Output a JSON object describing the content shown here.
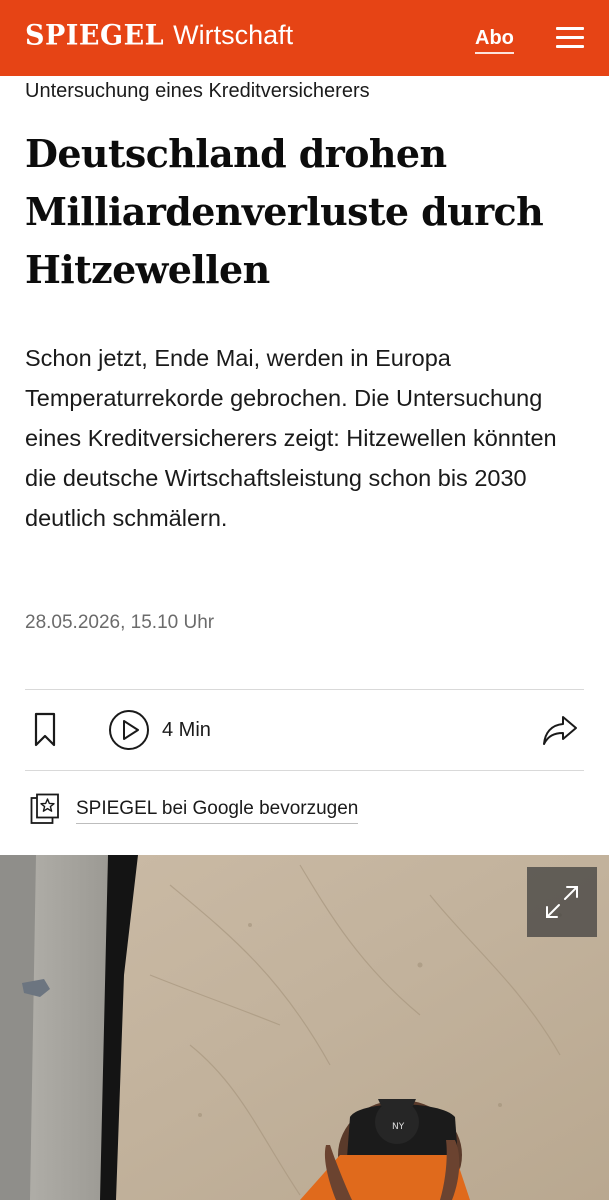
{
  "header": {
    "brand": "SPIEGEL",
    "section": "Wirtschaft",
    "abo_label": "Abo",
    "menu_icon": "hamburger-menu-icon",
    "bar_color": "#e64415"
  },
  "article": {
    "kicker": "Untersuchung eines Kreditversicherers",
    "headline": "Deutschland drohen Milliardenverluste durch Hitzewellen",
    "teaser": "Schon jetzt, Ende Mai, werden in Europa Temperaturrekorde gebrochen. Die Untersuchung eines Kreditversicherers zeigt: Hitzewellen könnten die deutsche Wirtschaftsleistung schon bis 2030 deutlich schmälern.",
    "date": "28.05.2026, 15.10 Uhr"
  },
  "toolbar": {
    "bookmark_icon": "bookmark-icon",
    "play_icon": "play-circle-icon",
    "duration": "4 Min",
    "share_icon": "share-arrow-icon"
  },
  "google": {
    "icon": "star-badge-icon",
    "label": "SPIEGEL bei Google bevorzugen"
  },
  "hero": {
    "image": "aerial view of a person in a black cap walking on a dry sandy construction surface",
    "expand_icon": "expand-arrows-icon"
  }
}
